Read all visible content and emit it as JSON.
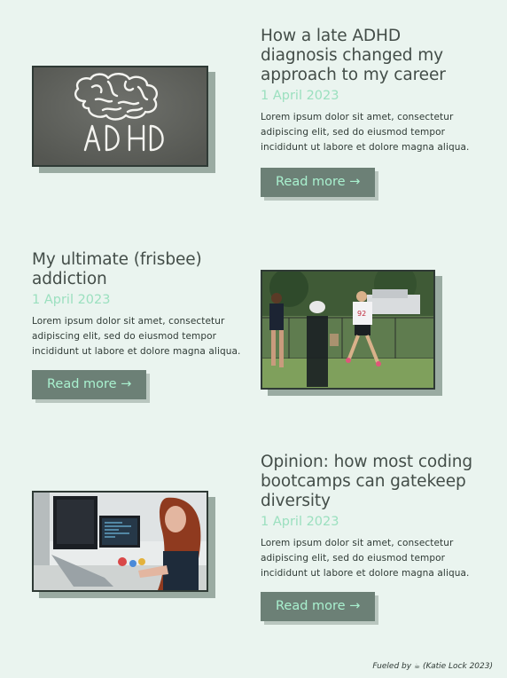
{
  "posts": [
    {
      "title": "How a late ADHD diagnosis changed my approach to my career",
      "date": "1 April 2023",
      "excerpt": "Lorem ipsum dolor sit amet, consectetur adipiscing elit, sed do eiusmod tempor incididunt ut labore et dolore magna aliqua.",
      "read_more": "Read more →",
      "image_text": "ADHD"
    },
    {
      "title": "My ultimate (frisbee) addiction",
      "date": "1 April 2023",
      "excerpt": "Lorem ipsum dolor sit amet, consectetur adipiscing elit, sed do eiusmod tempor incididunt ut labore et dolore magna aliqua.",
      "read_more": "Read more →"
    },
    {
      "title": "Opinion: how most coding bootcamps can gatekeep diversity",
      "date": "1 April 2023",
      "excerpt": "Lorem ipsum dolor sit amet, consectetur adipiscing elit, sed do eiusmod tempor incididunt ut labore et dolore magna aliqua.",
      "read_more": "Read more →"
    }
  ],
  "footer": {
    "prefix": "Fueled by",
    "icon": "coffee-icon",
    "suffix": "(Katie Lock 2023)"
  },
  "colors": {
    "background": "#eaf4ef",
    "button_bg": "#6c8076",
    "button_text": "#a9f1cf",
    "date": "#9be0bf",
    "shadow": "#9aaba2"
  }
}
